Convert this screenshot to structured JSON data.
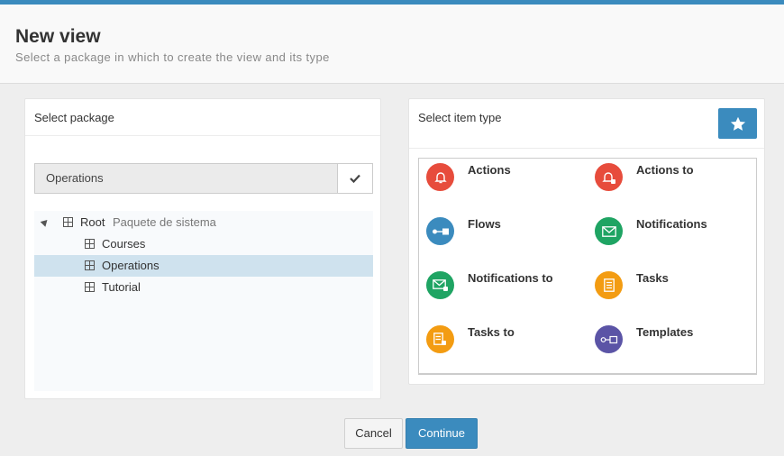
{
  "header": {
    "title": "New view",
    "subtitle": "Select a package in which to create the view and its type"
  },
  "package_panel": {
    "title": "Select package",
    "selected_value": "Operations",
    "tree": {
      "root_label": "Root",
      "root_description": "Paquete de sistema",
      "children": [
        "Courses",
        "Operations",
        "Tutorial"
      ]
    }
  },
  "type_panel": {
    "title": "Select item type",
    "items": [
      {
        "label": "Actions",
        "icon": "bell-icon",
        "color": "#e74c3c"
      },
      {
        "label": "Actions to",
        "icon": "bell-user-icon",
        "color": "#e74c3c"
      },
      {
        "label": "Flows",
        "icon": "flow-icon",
        "color": "#3b8bbe"
      },
      {
        "label": "Notifications",
        "icon": "envelope-icon",
        "color": "#1fa463"
      },
      {
        "label": "Notifications to",
        "icon": "envelope-user-icon",
        "color": "#1fa463"
      },
      {
        "label": "Tasks",
        "icon": "task-icon",
        "color": "#f39c12"
      },
      {
        "label": "Tasks to",
        "icon": "task-user-icon",
        "color": "#f39c12"
      },
      {
        "label": "Templates",
        "icon": "template-icon",
        "color": "#5b54a6"
      }
    ]
  },
  "footer": {
    "cancel_label": "Cancel",
    "continue_label": "Continue"
  },
  "colors": {
    "accent": "#3b8bbe",
    "selected_row": "#cfe2ee"
  }
}
